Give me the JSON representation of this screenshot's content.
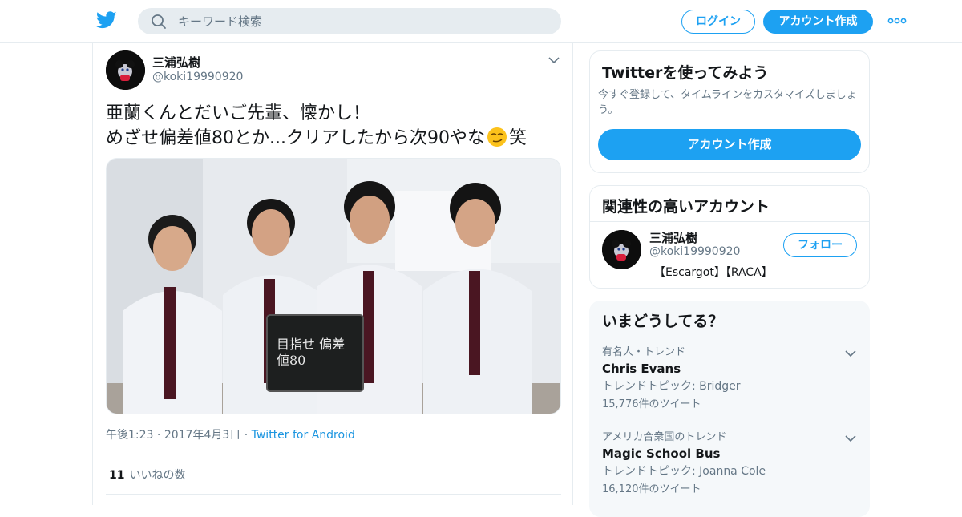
{
  "header": {
    "search_placeholder": "キーワード検索",
    "login_label": "ログイン",
    "signup_label": "アカウント作成"
  },
  "tweet": {
    "author_name": "三浦弘樹",
    "author_handle": "@koki19990920",
    "text_line1": "亜蘭くんとだいご先輩、懐かし！",
    "text_line2_a": "めざせ偏差値80とか...クリアしたから次90やな",
    "text_line2_b": "笑",
    "photo_sign_text": "目指せ 偏差値80",
    "time": "午後1:23",
    "date": "2017年4月3日",
    "source": "Twitter for Android",
    "likes_count": "11",
    "likes_label": "いいねの数"
  },
  "sidebar": {
    "join": {
      "title": "Twitterを使ってみよう",
      "description": "今すぐ登録して、タイムラインをカスタマイズしましょう。",
      "cta_label": "アカウント作成"
    },
    "related": {
      "title": "関連性の高いアカウント",
      "name": "三浦弘樹",
      "handle": "@koki19990920",
      "bio": "【Escargot】【RACA】",
      "follow_label": "フォロー"
    },
    "trends": {
      "title": "いまどうしてる？",
      "items": [
        {
          "context": "有名人・トレンド",
          "name": "Chris Evans",
          "topic": "トレンドトピック: Bridger",
          "count": "15,776件のツイート"
        },
        {
          "context": "アメリカ合衆国のトレンド",
          "name": "Magic School Bus",
          "topic": "トレンドトピック: Joanna Cole",
          "count": "16,120件のツイート"
        }
      ]
    }
  },
  "colors": {
    "brand": "#1da1f2",
    "text_primary": "#14171a",
    "text_secondary": "#657786",
    "border": "#e6ecf0"
  }
}
